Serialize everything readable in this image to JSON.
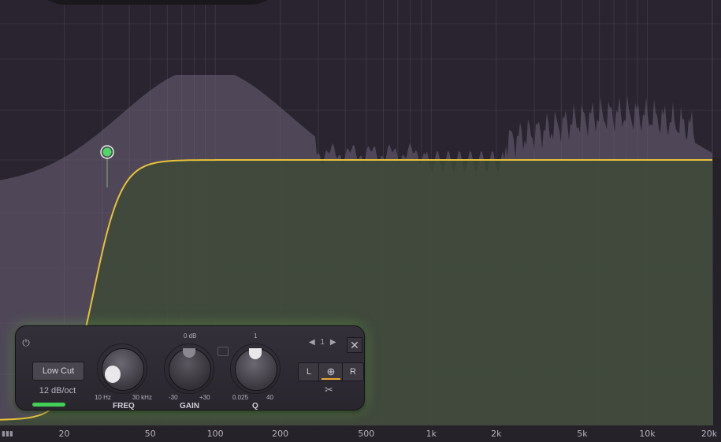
{
  "graph": {
    "x_ticks": [
      {
        "label": "20",
        "freq": 20
      },
      {
        "label": "50",
        "freq": 50
      },
      {
        "label": "100",
        "freq": 100
      },
      {
        "label": "200",
        "freq": 200
      },
      {
        "label": "500",
        "freq": 500
      },
      {
        "label": "1k",
        "freq": 1000
      },
      {
        "label": "2k",
        "freq": 2000
      },
      {
        "label": "5k",
        "freq": 5000
      },
      {
        "label": "10k",
        "freq": 10000
      },
      {
        "label": "20k",
        "freq": 20000
      }
    ],
    "colors": {
      "curve": "#e8c23a",
      "fill": "#3d4a37",
      "spectrum": "#6e6478",
      "grid": "#4a4550",
      "node": "#4cd964"
    }
  },
  "band_panel": {
    "filter_type_label": "Low Cut",
    "slope_label": "12 dB/oct",
    "band_number": "1",
    "freq": {
      "label": "FREQ",
      "min": "10 Hz",
      "max": "30 kHz"
    },
    "gain": {
      "label": "GAIN",
      "top": "0 dB",
      "min": "-30",
      "max": "+30"
    },
    "q": {
      "label": "Q",
      "top": "1",
      "min": "0.025",
      "max": "40"
    },
    "channel": {
      "left": "L",
      "right": "R"
    }
  }
}
